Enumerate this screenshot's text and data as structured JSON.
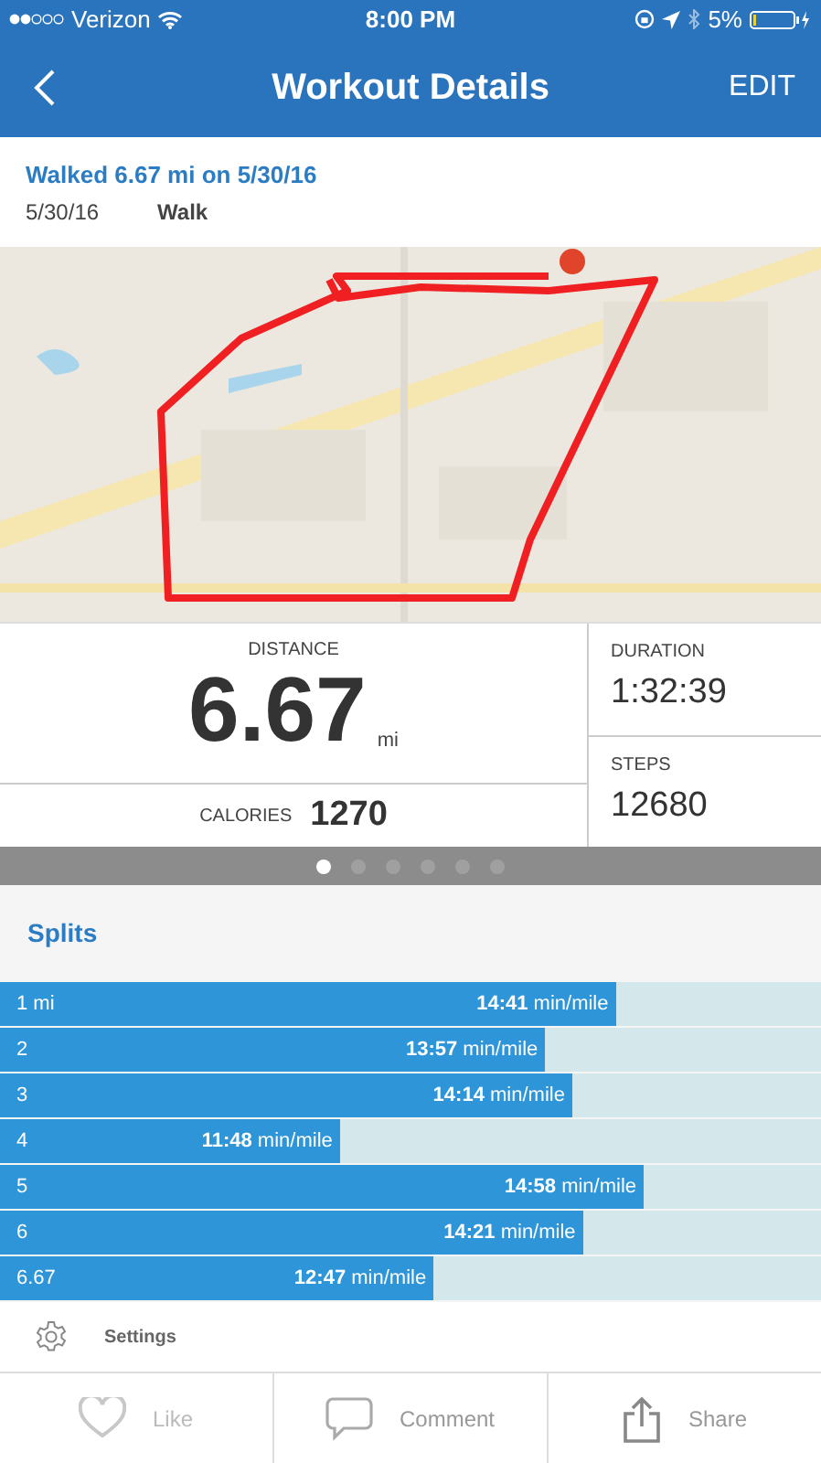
{
  "status_bar": {
    "carrier": "Verizon",
    "time": "8:00 PM",
    "battery": "5%"
  },
  "nav": {
    "title": "Workout Details",
    "action": "EDIT"
  },
  "header": {
    "title": "Walked 6.67 mi on 5/30/16",
    "date": "5/30/16",
    "type": "Walk"
  },
  "stats": {
    "distance_label": "DISTANCE",
    "distance": "6.67",
    "distance_unit": "mi",
    "calories_label": "CALORIES",
    "calories": "1270",
    "duration_label": "DURATION",
    "duration": "1:32:39",
    "steps_label": "STEPS",
    "steps": "12680"
  },
  "pages": [
    {
      "selected": true
    },
    {
      "selected": false
    },
    {
      "selected": false
    },
    {
      "selected": false
    },
    {
      "selected": false
    },
    {
      "selected": false
    }
  ],
  "splits": {
    "title": "Splits",
    "rows": [
      {
        "label": "1 mi",
        "pace": "**14:41** min/mile",
        "level": 0.75
      },
      {
        "label": "2",
        "pace": "**13:57** min/mile",
        "level": 0.664
      },
      {
        "label": "3",
        "pace": "**14:14** min/mile",
        "level": 0.697
      },
      {
        "label": "4",
        "pace": "**11:48** min/mile",
        "level": 0.414
      },
      {
        "label": "5",
        "pace": "**14:58** min/mile",
        "level": 0.784
      },
      {
        "label": "6",
        "pace": "**14:21** min/mile",
        "level": 0.71
      },
      {
        "label": "6.67",
        "pace": "**12:47** min/mile",
        "level": 0.528
      }
    ]
  },
  "settings": "Settings",
  "actions": [
    {
      "kind": "like",
      "label": "Like"
    },
    {
      "kind": "comment",
      "label": "Comment"
    },
    {
      "kind": "share",
      "label": "Share"
    }
  ]
}
